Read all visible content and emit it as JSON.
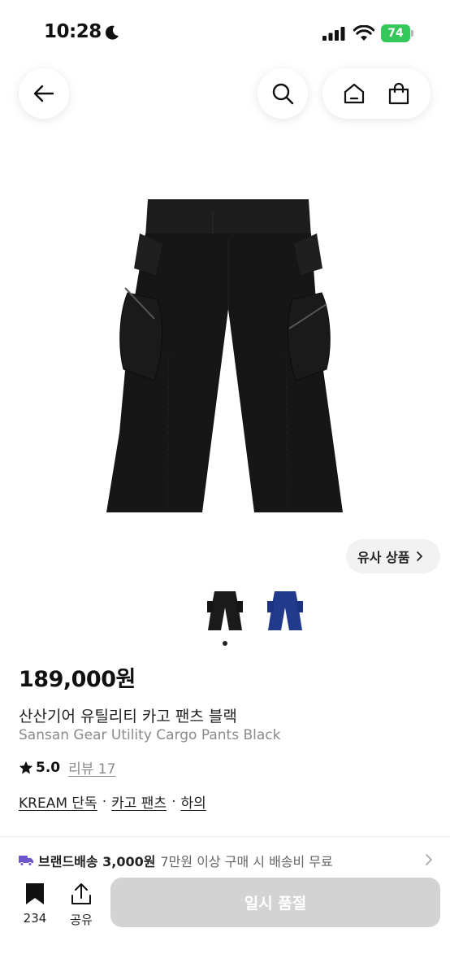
{
  "status_bar": {
    "time": "10:28",
    "battery": "74"
  },
  "nav": {
    "back_icon": "arrow-left-icon",
    "search_icon": "search-icon",
    "home_icon": "home-icon",
    "bag_icon": "shopping-bag-icon"
  },
  "gallery": {
    "similar_label": "유사 상품",
    "thumbnails": [
      "black",
      "blue"
    ],
    "selected_index": 0
  },
  "product": {
    "price": "189,000원",
    "name_ko": "산산기어 유틸리티 카고 팬츠 블랙",
    "name_en": "Sansan Gear Utility Cargo Pants Black",
    "rating": "5.0",
    "review_label": "리뷰 17",
    "tags": [
      "KREAM 단독",
      "카고 팬츠",
      "하의"
    ],
    "tag_separator": "·"
  },
  "shipping": {
    "label": "브랜드배송 3,000원",
    "note": "7만원 이상 구매 시 배송비 무료"
  },
  "bottom_bar": {
    "bookmark_count": "234",
    "share_label": "공유",
    "buy_label": "일시 품절"
  },
  "colors": {
    "accent_purple": "#6e56cf",
    "battery_green": "#34c759",
    "disabled_button": "#d3d3d3"
  }
}
